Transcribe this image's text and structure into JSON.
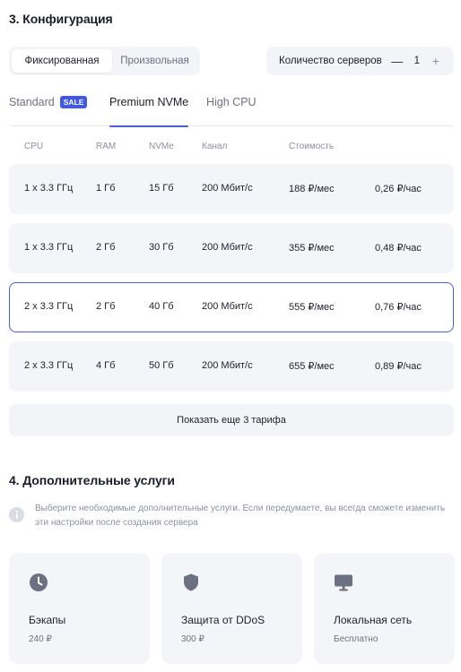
{
  "section3": {
    "title": "3. Конфигурация",
    "mode_options": [
      "Фиксированная",
      "Произвольная"
    ],
    "mode_selected": "Фиксированная",
    "server_count_label": "Количество серверов",
    "server_count_minus": "—",
    "server_count": "1",
    "server_count_plus": "+"
  },
  "tabs": [
    {
      "label": "Standard",
      "badge": "SALE",
      "active": false
    },
    {
      "label": "Premium NVMe",
      "active": true
    },
    {
      "label": "High CPU",
      "active": false
    }
  ],
  "table": {
    "headers": [
      "CPU",
      "RAM",
      "NVMe",
      "Канал",
      "Стоимость"
    ],
    "rows": [
      {
        "cpu": "1 x 3.3 ГГц",
        "ram": "1 Гб",
        "nvme": "15 Гб",
        "channel": "200 Мбит/с",
        "monthly": "188 ₽/мес",
        "hourly": "0,26 ₽/час",
        "selected": false
      },
      {
        "cpu": "1 x 3.3 ГГц",
        "ram": "2 Гб",
        "nvme": "30 Гб",
        "channel": "200 Мбит/с",
        "monthly": "355 ₽/мес",
        "hourly": "0,48 ₽/час",
        "selected": false
      },
      {
        "cpu": "2 x 3.3 ГГц",
        "ram": "2 Гб",
        "nvme": "40 Гб",
        "channel": "200 Мбит/с",
        "monthly": "555 ₽/мес",
        "hourly": "0,76 ₽/час",
        "selected": true
      },
      {
        "cpu": "2 x 3.3 ГГц",
        "ram": "4 Гб",
        "nvme": "50 Гб",
        "channel": "200 Мбит/с",
        "monthly": "655 ₽/мес",
        "hourly": "0,89 ₽/час",
        "selected": false
      }
    ],
    "show_more": "Показать еще 3 тарифа"
  },
  "section4": {
    "title": "4. Дополнительные услуги",
    "info_icon": "info-icon",
    "info_text": "Выберите необходимые дополнительные услуги. Если передумаете, вы всегда сможете изменить эти настройки после создания сервера",
    "cards": [
      {
        "icon": "clock-icon",
        "name": "Бэкапы",
        "price": "240 ₽"
      },
      {
        "icon": "shield-icon",
        "name": "Защита от DDoS",
        "price": "300 ₽"
      },
      {
        "icon": "monitor-icon",
        "name": "Локальная сеть",
        "price": "Бесплатно"
      }
    ]
  },
  "colors": {
    "accent": "#4a5ed9",
    "sale_badge": "#4157e8",
    "row_bg": "#f4f5f8",
    "icon": "#6b7180"
  }
}
